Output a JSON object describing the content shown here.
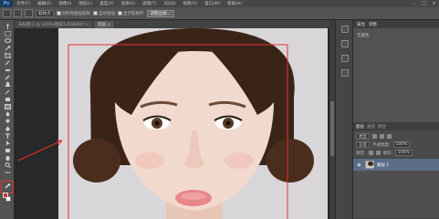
{
  "menubar": {
    "logo": "Ps",
    "items": [
      "文件(F)",
      "编辑(E)",
      "图像(I)",
      "图层(L)",
      "类型(Y)",
      "选择(S)",
      "滤镜(T)",
      "3D(D)",
      "视图(V)",
      "窗口(W)",
      "帮助(H)"
    ]
  },
  "optionsbar": {
    "sample_size": "取样点",
    "sample_all_layers": "对所有图层取样",
    "auto_enhance": "自动增强",
    "show_ring": "显示取样环",
    "refine_edge": "调整边缘..."
  },
  "doc_tabs": [
    {
      "label": "未标题-1 @ 100%(图层1,RGB/8#) ×",
      "active": false
    },
    {
      "label": "图层 ×",
      "active": true
    }
  ],
  "properties": {
    "tabs": [
      "属性",
      "调整"
    ],
    "label": "无属性"
  },
  "layers": {
    "tabs": [
      "图层",
      "通道",
      "路径"
    ],
    "filter_kind": "类型",
    "blend_mode": "正常",
    "opacity_label": "不透明度:",
    "opacity_value": "100%",
    "lock_label": "锁定:",
    "fill_label": "填充:",
    "fill_value": "100%",
    "layer_name": "图层 1"
  },
  "colors": {
    "foreground": "#c83737",
    "background": "#ffffff",
    "annotation": "#e53030",
    "selected_layer": "#5a6c88"
  }
}
